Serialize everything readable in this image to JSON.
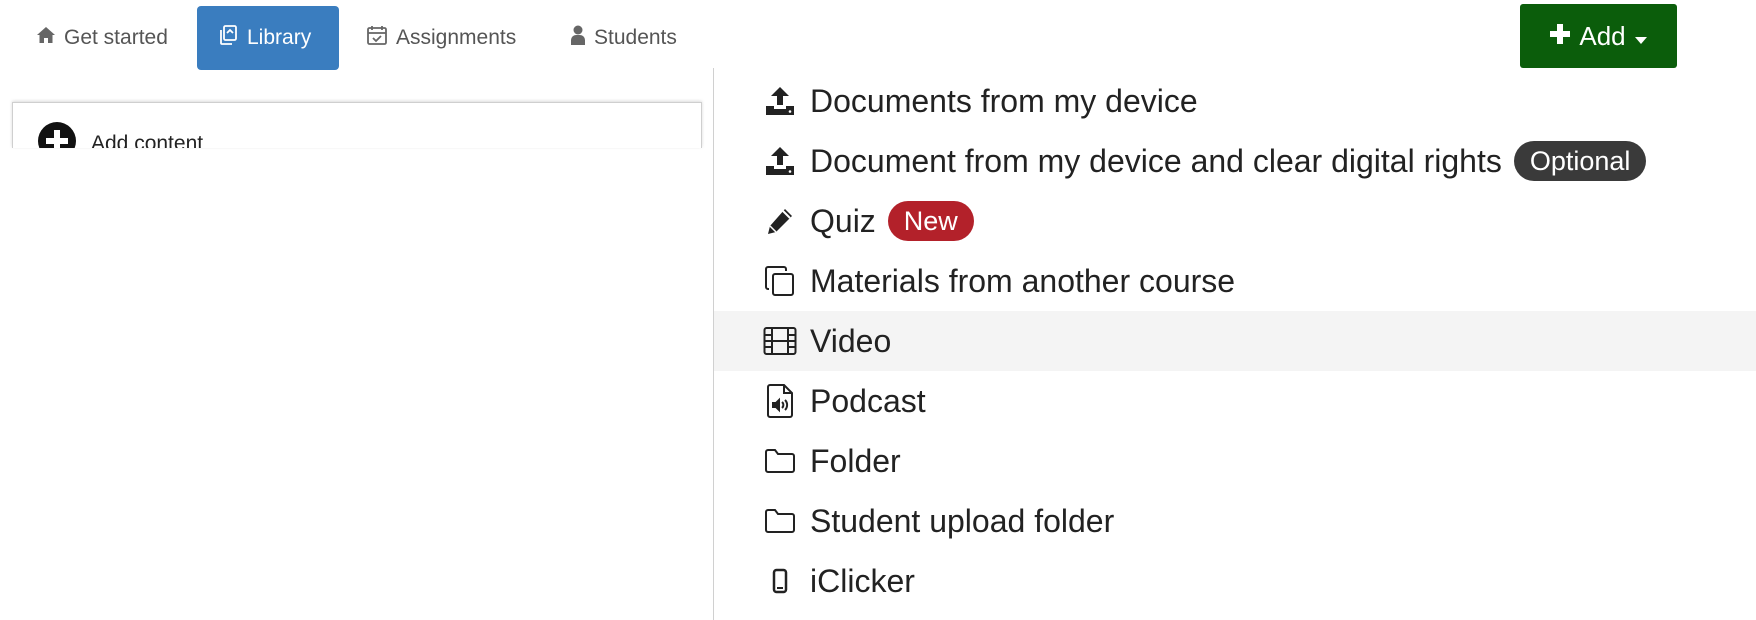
{
  "nav": {
    "tabs": [
      {
        "label": "Get started",
        "icon": "home-icon"
      },
      {
        "label": "Library",
        "icon": "library-icon",
        "active": true
      },
      {
        "label": "Assignments",
        "icon": "calendar-check-icon"
      },
      {
        "label": "Students",
        "icon": "user-icon"
      }
    ],
    "add_button": {
      "label": "Add",
      "icon": "plus-icon",
      "caret": "chevron-down-icon"
    }
  },
  "library": {
    "add_content_label": "Add content",
    "add_content_icon": "plus-circle-icon"
  },
  "add_menu": {
    "items": [
      {
        "label": "Documents from my device",
        "icon": "upload-icon"
      },
      {
        "label": "Document from my device and clear digital rights",
        "icon": "upload-icon",
        "badge": "Optional"
      },
      {
        "label": "Quiz",
        "icon": "pencil-icon",
        "badge": "New"
      },
      {
        "label": "Materials from another course",
        "icon": "copy-icon"
      },
      {
        "label": "Video",
        "icon": "film-icon",
        "hovered": true
      },
      {
        "label": "Podcast",
        "icon": "audio-file-icon"
      },
      {
        "label": "Folder",
        "icon": "folder-icon"
      },
      {
        "label": "Student upload folder",
        "icon": "folder-icon"
      },
      {
        "label": "iClicker",
        "icon": "phone-icon"
      }
    ]
  },
  "colors": {
    "active_tab": "#3a7dbf",
    "add_button": "#0b5d0b",
    "badge_optional": "#3a3a3a",
    "badge_new": "#b3212a",
    "hover_row": "#f4f4f4"
  }
}
